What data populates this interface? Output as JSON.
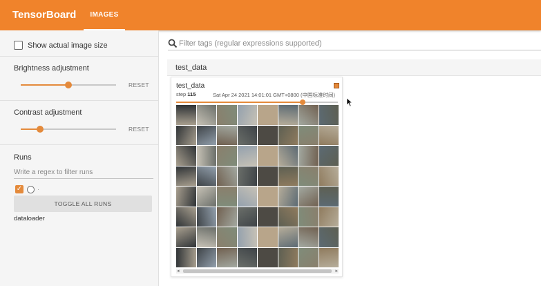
{
  "app": {
    "title": "TensorBoard",
    "active_tab": "IMAGES"
  },
  "sidebar": {
    "show_actual_size_label": "Show actual image size",
    "brightness": {
      "label": "Brightness adjustment",
      "reset_label": "RESET",
      "value_fraction": 0.5
    },
    "contrast": {
      "label": "Contrast adjustment",
      "reset_label": "RESET",
      "value_fraction": 0.2
    },
    "runs": {
      "title": "Runs",
      "filter_placeholder": "Write a regex to filter runs",
      "toggle_all_label": "TOGGLE ALL RUNS",
      "run_name": "dataloader",
      "run_checked": true,
      "run_color": "#e48a3b"
    }
  },
  "main": {
    "filter_placeholder": "Filter tags (regular expressions supported)",
    "group_label": "test_data",
    "card": {
      "title": "test_data",
      "step_label": "step",
      "step_value": "115",
      "timestamp": "Sat Apr 24 2021 14:01:01 GMT+0800 (中国标准时间)",
      "step_slider_fraction": 0.78
    }
  },
  "colors": {
    "accent": "#f0832b",
    "slider": "#e48a3b"
  },
  "icons": {
    "search": "search-icon",
    "pin": "pin-icon"
  }
}
